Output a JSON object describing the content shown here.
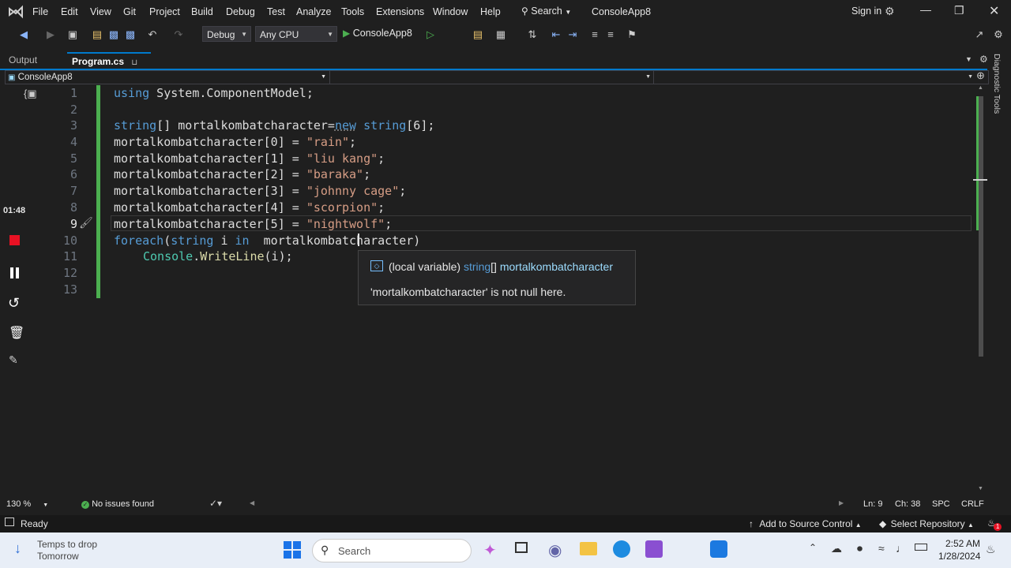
{
  "menu": [
    "File",
    "Edit",
    "View",
    "Git",
    "Project",
    "Build",
    "Debug",
    "Test",
    "Analyze",
    "Tools",
    "Extensions",
    "Window",
    "Help"
  ],
  "search_label": "Search",
  "app_title": "ConsoleApp8",
  "sign_in": "Sign in",
  "toolbar": {
    "config": "Debug",
    "platform": "Any CPU",
    "run_label": "ConsoleApp8"
  },
  "tabs": {
    "output": "Output",
    "program": "Program.cs"
  },
  "navbar": {
    "project": "ConsoleApp8"
  },
  "side_panel": "Diagnostic Tools",
  "timer": "01:48",
  "code_lines": [
    {
      "n": "1"
    },
    {
      "n": "2"
    },
    {
      "n": "3"
    },
    {
      "n": "4"
    },
    {
      "n": "5"
    },
    {
      "n": "6"
    },
    {
      "n": "7"
    },
    {
      "n": "8"
    },
    {
      "n": "9"
    },
    {
      "n": "10"
    },
    {
      "n": "11"
    },
    {
      "n": "12"
    },
    {
      "n": "13"
    }
  ],
  "code": {
    "l1_kw": "using",
    "l1_rest": " System.ComponentModel;",
    "l3_a": "string",
    "l3_b": "[] mortalkombatcharacter=",
    "l3_c": "new",
    "l3_d": " ",
    "l3_e": "string",
    "l3_f": "[6];",
    "l4_a": "mortalkombatcharacter[0] = ",
    "l4_s": "\"rain\"",
    "l5_a": "mortalkombatcharacter[1] = ",
    "l5_s": "\"liu kang\"",
    "l6_a": "mortalkombatcharacter[2] = ",
    "l6_s": "\"baraka\"",
    "l7_a": "mortalkombatcharacter[3] = ",
    "l7_s": "\"johnny cage\"",
    "l8_a": "mortalkombatcharacter[4] = ",
    "l8_s": "\"scorpion\"",
    "l9_a": "mortalkombatcharacter[5] = ",
    "l9_s": "\"nightwolf\"",
    "l10_a": "foreach",
    "l10_b": "(",
    "l10_c": "string",
    "l10_d": " i ",
    "l10_e": "in",
    "l10_f": "  mortalkombatcharacter)",
    "l11_a": "Console",
    "l11_b": ".",
    "l11_c": "WriteLine",
    "l11_d": "(i);",
    "semi": ";"
  },
  "tooltip": {
    "prefix": "(local variable) ",
    "type": "string",
    "brackets": "[] ",
    "name": "mortalkombatcharacter",
    "note": "'mortalkombatcharacter' is not null here."
  },
  "editor_status": {
    "zoom": "130 %",
    "issues": "No issues found",
    "ln": "Ln: 9",
    "ch": "Ch: 38",
    "spc": "SPC",
    "crlf": "CRLF"
  },
  "status": {
    "ready": "Ready",
    "source_control": "Add to Source Control",
    "repo": "Select Repository",
    "notif": "1"
  },
  "taskbar": {
    "weather1": "Temps to drop",
    "weather2": "Tomorrow",
    "search": "Search",
    "time": "2:52 AM",
    "date": "1/28/2024"
  },
  "colors": {
    "accent": "#007acc",
    "green_bar": "#4caf50",
    "stop_red": "#e81123"
  }
}
